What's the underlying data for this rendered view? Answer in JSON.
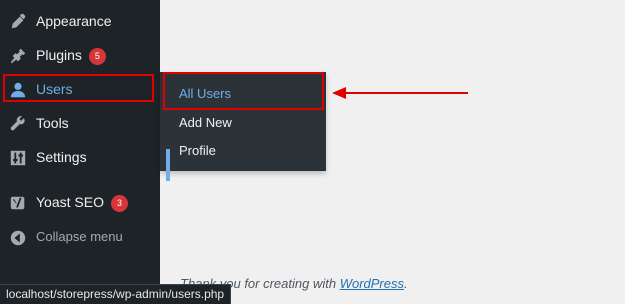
{
  "sidebar": {
    "items": [
      {
        "label": "Appearance",
        "icon": "paintbrush-icon"
      },
      {
        "label": "Plugins",
        "icon": "plugin-icon",
        "badge": "5"
      },
      {
        "label": "Users",
        "icon": "user-icon"
      },
      {
        "label": "Tools",
        "icon": "wrench-icon"
      },
      {
        "label": "Settings",
        "icon": "settings-sliders-icon"
      },
      {
        "label": "Yoast SEO",
        "icon": "yoast-icon",
        "badge": "3"
      },
      {
        "label": "Collapse menu",
        "icon": "collapse-icon"
      }
    ]
  },
  "submenu": {
    "items": [
      {
        "label": "All Users"
      },
      {
        "label": "Add New"
      },
      {
        "label": "Profile"
      }
    ]
  },
  "footer": {
    "text": "Thank you for creating with ",
    "link": "WordPress",
    "suffix": "."
  },
  "statusbar": {
    "url": "localhost/storepress/wp-admin/users.php"
  },
  "colors": {
    "sidebar_bg": "#1d2327",
    "submenu_bg": "#2c3338",
    "accent": "#72aee6",
    "badge": "#d63638",
    "annotation": "#e00000"
  }
}
